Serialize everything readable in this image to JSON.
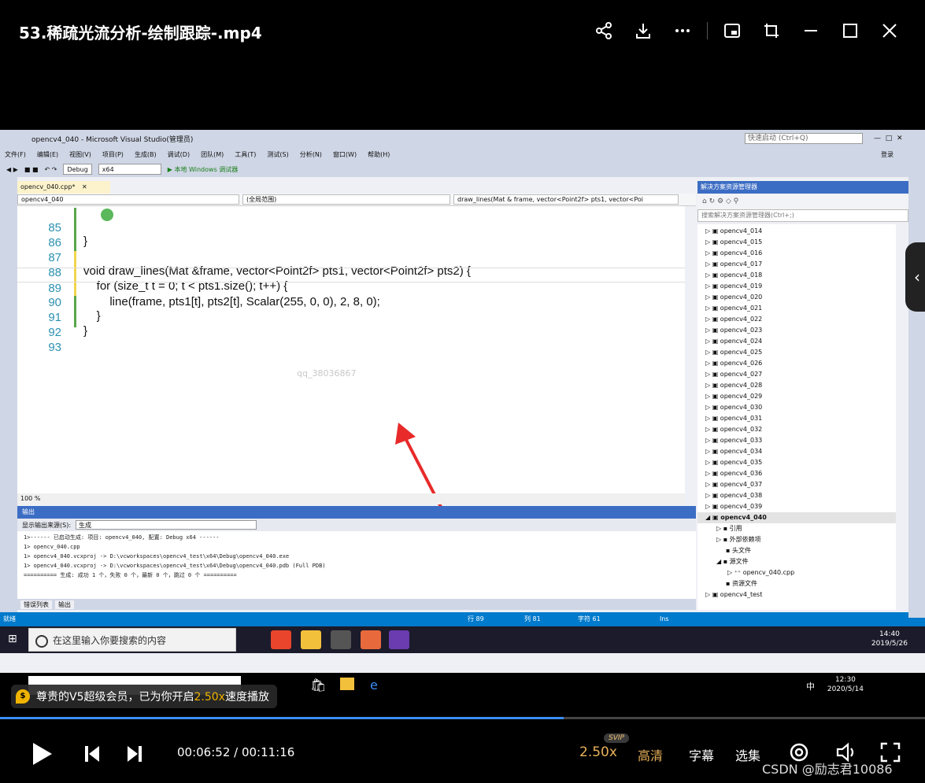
{
  "player": {
    "title": "53.稀疏光流分析-绘制跟踪-.mp4",
    "icons": [
      "share-icon",
      "download-icon",
      "more-icon",
      "pip-icon",
      "mini-icon",
      "minimize-icon",
      "maximize-icon",
      "close-icon"
    ]
  },
  "vs": {
    "window_title": "opencv4_040 - Microsoft Visual Studio(管理员)",
    "quick_launch": "快速启动 (Ctrl+Q)",
    "login": "登录",
    "menu": [
      "文件(F)",
      "编辑(E)",
      "视图(V)",
      "项目(P)",
      "生成(B)",
      "调试(D)",
      "团队(M)",
      "工具(T)",
      "测试(S)",
      "分析(N)",
      "窗口(W)",
      "帮助(H)"
    ],
    "toolbar": {
      "config": "Debug",
      "platform": "x64",
      "run": "▶ 本地 Windows 调试器"
    },
    "editor_tab": "opencv_040.cpp*",
    "nav": {
      "project": "opencv4_040",
      "scope": "(全局范围)",
      "member": "draw_lines(Mat & frame, vector<Point2f> pts1, vector<Poi"
    },
    "code_lines": [
      {
        "num": "85",
        "text": "}"
      },
      {
        "num": "86",
        "text": ""
      },
      {
        "num": "87",
        "text": "void draw_lines(Mat &frame, vector<Point2f> pts1, vector<Point2f> pts2) {"
      },
      {
        "num": "88",
        "text": "    for (size_t t = 0; t < pts1.size(); t++) {"
      },
      {
        "num": "89",
        "text": "        line(frame, pts1[t], pts2[t], Scalar(255, 0, 0), 2, 8, 0);"
      },
      {
        "num": "90",
        "text": "    }"
      },
      {
        "num": "91",
        "text": "}"
      },
      {
        "num": "92",
        "text": ""
      },
      {
        "num": "93",
        "text": ""
      }
    ],
    "watermark": "qq_38036867",
    "zoom": "100 %",
    "output": {
      "title": "输出",
      "source_label": "显示输出来源(S):",
      "source_value": "生成",
      "lines": [
        "1>------ 已启动生成: 项目: opencv4_040, 配置: Debug x64 ------",
        "1>  opencv_040.cpp",
        "1>  opencv4_040.vcxproj -> D:\\vcworkspaces\\opencv4_test\\x64\\Debug\\opencv4_040.exe",
        "1>  opencv4_040.vcxproj -> D:\\vcworkspaces\\opencv4_test\\x64\\Debug\\opencv4_040.pdb (Full PDB)",
        "========== 生成: 成功 1 个，失败 0 个，最新 0 个，跳过 0 个 =========="
      ]
    },
    "bottom_tabs": [
      "错误列表",
      "输出"
    ],
    "status": {
      "ready": "就绪",
      "row": "行 89",
      "col": "列 81",
      "char": "字符 61",
      "ins": "Ins"
    },
    "solution": {
      "title": "解决方案资源管理器",
      "search": "搜索解决方案资源管理器(Ctrl+;)",
      "items": [
        "opencv4_014",
        "opencv4_015",
        "opencv4_016",
        "opencv4_017",
        "opencv4_018",
        "opencv4_019",
        "opencv4_020",
        "opencv4_021",
        "opencv4_022",
        "opencv4_023",
        "opencv4_024",
        "opencv4_025",
        "opencv4_026",
        "opencv4_027",
        "opencv4_028",
        "opencv4_029",
        "opencv4_030",
        "opencv4_031",
        "opencv4_032",
        "opencv4_033",
        "opencv4_034",
        "opencv4_035",
        "opencv4_036",
        "opencv4_037",
        "opencv4_038",
        "opencv4_039",
        "opencv4_040",
        "引用",
        "外部依赖项",
        "头文件",
        "源文件",
        "opencv_040.cpp",
        "资源文件",
        "opencv4_test"
      ]
    }
  },
  "taskbar": {
    "search_placeholder": "在这里输入你要搜索的内容",
    "time": "14:40",
    "date": "2019/5/26",
    "time2": "12:30",
    "date2": "2020/5/14",
    "ime": "中"
  },
  "notice": {
    "text_a": "尊贵的V5超级会员，已为你开启",
    "speed": "2.50x",
    "text_b": "速度播放"
  },
  "controls": {
    "time": "00:06:52 / 00:11:16",
    "progress": 0.609,
    "speed": "2.50x",
    "svip": "SVIP",
    "quality": "高清",
    "subtitle": "字幕",
    "episodes": "选集",
    "credit": "CSDN @励志君10086"
  }
}
